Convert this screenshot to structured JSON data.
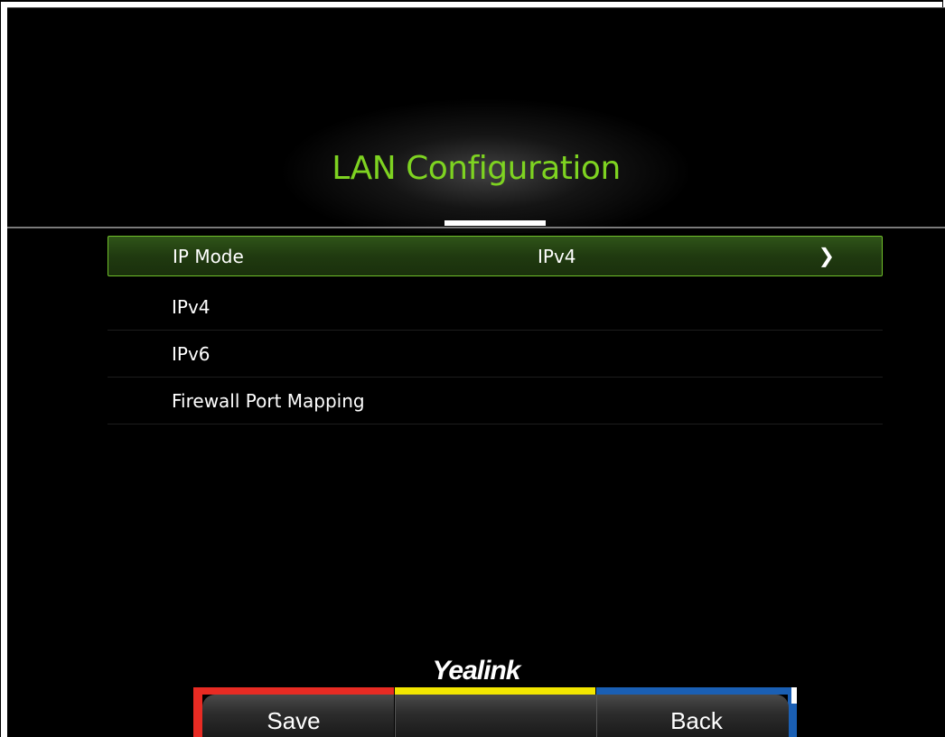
{
  "header": {
    "title": "LAN Configuration"
  },
  "menu": {
    "items": [
      {
        "label": "IP Mode",
        "value": "IPv4",
        "selected": true,
        "icon": "chevron-right-icon"
      },
      {
        "label": "IPv4"
      },
      {
        "label": "IPv6"
      },
      {
        "label": "Firewall Port Mapping"
      }
    ]
  },
  "brand": {
    "logo_text": "Yealink"
  },
  "softkeys": [
    {
      "label": "Save",
      "color": "#e82b23"
    },
    {
      "label": "",
      "color": "#f2e600"
    },
    {
      "label": "Back",
      "color": "#1a5fb4"
    }
  ],
  "colors": {
    "accent": "#7ed321",
    "selected_border": "#6fbf2a",
    "selected_bg": "#2a4a14",
    "background": "#000000"
  }
}
